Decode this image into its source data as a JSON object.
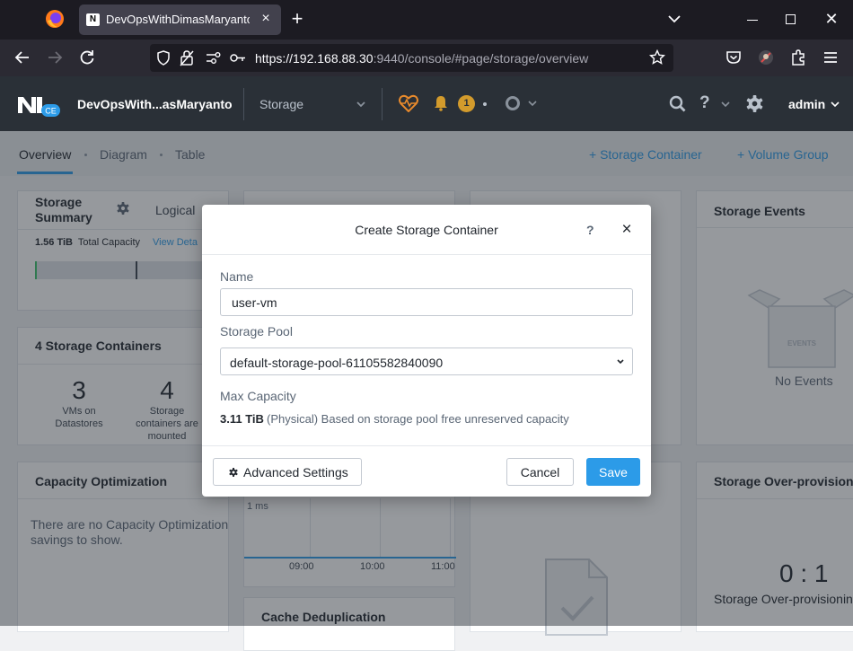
{
  "browser": {
    "tab_title": "DevOpsWithDimasMaryanto - N",
    "tab_favicon": "N",
    "url_host": "https://192.168.88.30",
    "url_rest": ":9440/console/#page/storage/overview"
  },
  "header": {
    "logo_badge": "CE",
    "cluster_name": "DevOpsWith...asMaryanto",
    "section": "Storage",
    "alert_count": "1",
    "user": "admin",
    "help_glyph": "?"
  },
  "subnav": {
    "tabs": [
      "Overview",
      "Diagram",
      "Table"
    ],
    "actions": [
      "+ Storage Container",
      "+ Volume Group"
    ]
  },
  "widgets": {
    "summary": {
      "title_line1": "Storage",
      "title_line2": "Summary",
      "mode": "Logical",
      "capacity_value": "1.56 TiB",
      "capacity_label": "Total Capacity",
      "view_link": "View Deta"
    },
    "containers": {
      "title": "4 Storage Containers",
      "stat1_value": "3",
      "stat1_label_line1": "VMs on",
      "stat1_label_line2": "Datastores",
      "stat2_value": "4",
      "stat2_label_line1": "Storage",
      "stat2_label_line2": "containers are",
      "stat2_label_line3": "mounted"
    },
    "capacity_opt": {
      "title": "Capacity Optimization",
      "message_line1": "There are no Capacity Optimization",
      "message_line2": "savings to show."
    },
    "latency": {
      "y_label": "1 ms",
      "x_ticks": [
        "09:00",
        "10:00",
        "11:00"
      ]
    },
    "cache": {
      "title": "Cache Deduplication"
    },
    "events": {
      "title": "Storage Events",
      "box_label": "EVENTS",
      "message": "No Events"
    },
    "overprov": {
      "title": "Storage Over-provisionin",
      "ratio": "0 : 1",
      "caption": "Storage Over-provisionin"
    }
  },
  "modal": {
    "title": "Create Storage Container",
    "help": "?",
    "name_label": "Name",
    "name_value": "user-vm",
    "pool_label": "Storage Pool",
    "pool_value": "default-storage-pool-61105582840090",
    "max_label": "Max Capacity",
    "max_value": "3.11 TiB",
    "max_desc": "(Physical) Based on storage pool free unreserved capacity",
    "advanced_label": "Advanced Settings",
    "cancel_label": "Cancel",
    "save_label": "Save"
  },
  "colors": {
    "accent": "#2c9be8",
    "header_bg": "#2a3037",
    "alert_badge": "#d39b2c",
    "health_heart": "#e88a2c"
  }
}
